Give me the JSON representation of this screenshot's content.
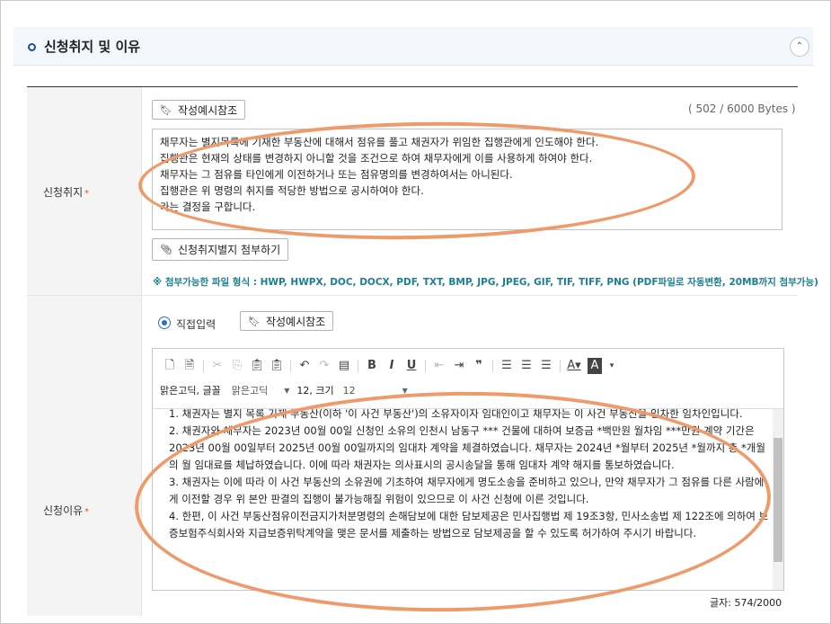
{
  "section": {
    "title": "신청취지 및 이유",
    "collapse_symbol": "⌃"
  },
  "row1": {
    "label": "신청취지",
    "required_mark": "*",
    "example_button": "작성예시참조",
    "byte_count": "( 502 / 6000 Bytes )",
    "lines": [
      "채무자는 별지목록에 기재한 부동산에 대해서 점유를 풀고 채권자가 위임한 집행관에게 인도해야 한다.",
      "집행관은 현재의 상태를 변경하지 아니할 것을 조건으로 하여 채무자에게 이를 사용하게 하여야 한다.",
      "채무자는 그 점유를 타인에게 이전하거나 또는 점유명의를 변경하여서는 아니된다.",
      "집행관은 위 명령의 취지를 적당한 방법으로 공시하여야 한다.",
      "라는 결정을 구합니다."
    ],
    "attach_button": "신청취지별지 첨부하기",
    "file_note": "※ 첨부가능한 파일 형식 : HWP, HWPX, DOC, DOCX, PDF, TXT, BMP, JPG, JPEG, GIF, TIF, TIFF, PNG (PDF파일로 자동변환, 20MB까지 첨부가능)"
  },
  "row2": {
    "label": "신청이유",
    "required_mark": "*",
    "radio_label": "직접입력",
    "example_button": "작성예시참조",
    "font_label": "맑은고딕, 글꼴",
    "font_value": "맑은고딕",
    "size_label": "12, 크기",
    "size_value": "12",
    "paragraphs": [
      "1. 채권자는 별지 목록 기재 부동산(이하 '이 사건 부동산')의 소유자이자 임대인이고 채무자는 이 사건 부동산을 임차한 임차인입니다.",
      "2. 채권자와 채무자는 2023년 00월 00일 신청인 소유의 인천시 남동구 *** 건물에 대하여 보증금 *백만원 월차임 ***만원 계약 기간은 2023년 00월 00일부터 2025년 00월 00일까지의 임대차 계약을 체결하였습니다. 채무자는 2024년 *월부터 2025년 *월까지 총 *개월의 월 임대료를 체납하였습니다. 이에 따라 채권자는 의사표시의 공시송달을 통해 임대차 계약 해지를 통보하였습니다.",
      "3. 채권자는 이에 따라 이 사건 부동산의 소유권에 기초하여 채무자에게 명도소송을 준비하고 있으나, 만약 채무자가 그 점유를 다른 사람에게 이전할 경우 위 본안 판결의 집행이 불가능해질 위험이 있으므로 이 사건 신청에 이른 것입니다.",
      "4. 한편, 이 사건 부동산점유이전금지가처분명령의 손해담보에 대한 담보제공은 민사집행법 제 19조3항, 민사소송법 제 122조에 의하여 보증보험주식회사와 지급보증위탁계약을 맺은 문서를 제출하는 방법으로 담보제공을 할 수 있도록 허가하여 주시기 바랍니다."
    ],
    "char_count": "글자: 574/2000"
  },
  "colors": {
    "annotation": "#ef9a6a",
    "accent": "#1f4f96",
    "note": "#1a7f94"
  }
}
